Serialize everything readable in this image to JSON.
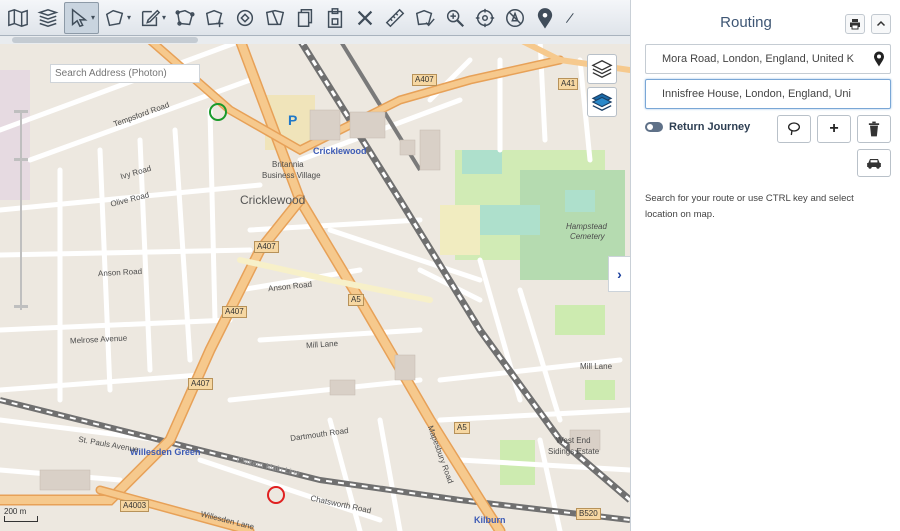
{
  "map": {
    "search_placeholder": "Search Address (Photon)",
    "labels": {
      "cricklewood_station": "Cricklewood",
      "cricklewood_area": "Cricklewood",
      "britannia": "Britannia",
      "business_village": "Business Village",
      "willesden_green": "Willesden Green",
      "kilburn": "Kilburn",
      "west_end_sidings": "West End",
      "sidings_estate": "Sidings Estate",
      "hampstead_cemetery_1": "Hampstead",
      "hampstead_cemetery_2": "Cemetery",
      "chiltern_main_line": "Chiltern Main Line",
      "arnos_road_1": "Anson Road",
      "arnos_road_2": "Anson Road",
      "melrose_avenue": "Melrose Avenue",
      "mill_lane": "Mill Lane",
      "mill_lane_2": "Mill Lane",
      "willesden_lane": "Willesden Lane",
      "tempsford": "Tempsford Road",
      "dartmouth": "Dartmouth Road",
      "mapesbury": "Mapesbury Road",
      "chatsworth": "Chatsworth Road",
      "st_pauls": "St. Pauls Avenue",
      "olive_road": "Olive Road",
      "ivy_road": "Ivy Road",
      "parking": "P"
    },
    "shields": {
      "a407_top": "A407",
      "a41": "A41",
      "a407_mid": "A407",
      "a407_low": "A407",
      "a407_left": "A407",
      "a4003": "A4003",
      "a5_mid": "A5",
      "a5_low": "A5",
      "b520": "B520"
    },
    "scale_top": "200 m",
    "scale_bottom": "200 ft",
    "collapse_glyph": "›"
  },
  "panel": {
    "title": "Routing",
    "print_glyph": "⎙",
    "collapse_glyph": "˄",
    "from_value": "Mora Road, London, England, United K",
    "to_value": "Innisfree House, London, England, Uni",
    "return_label": "Return Journey",
    "add_glyph": "+",
    "help_text": "Search for your route or use CTRL key and select location on map."
  }
}
